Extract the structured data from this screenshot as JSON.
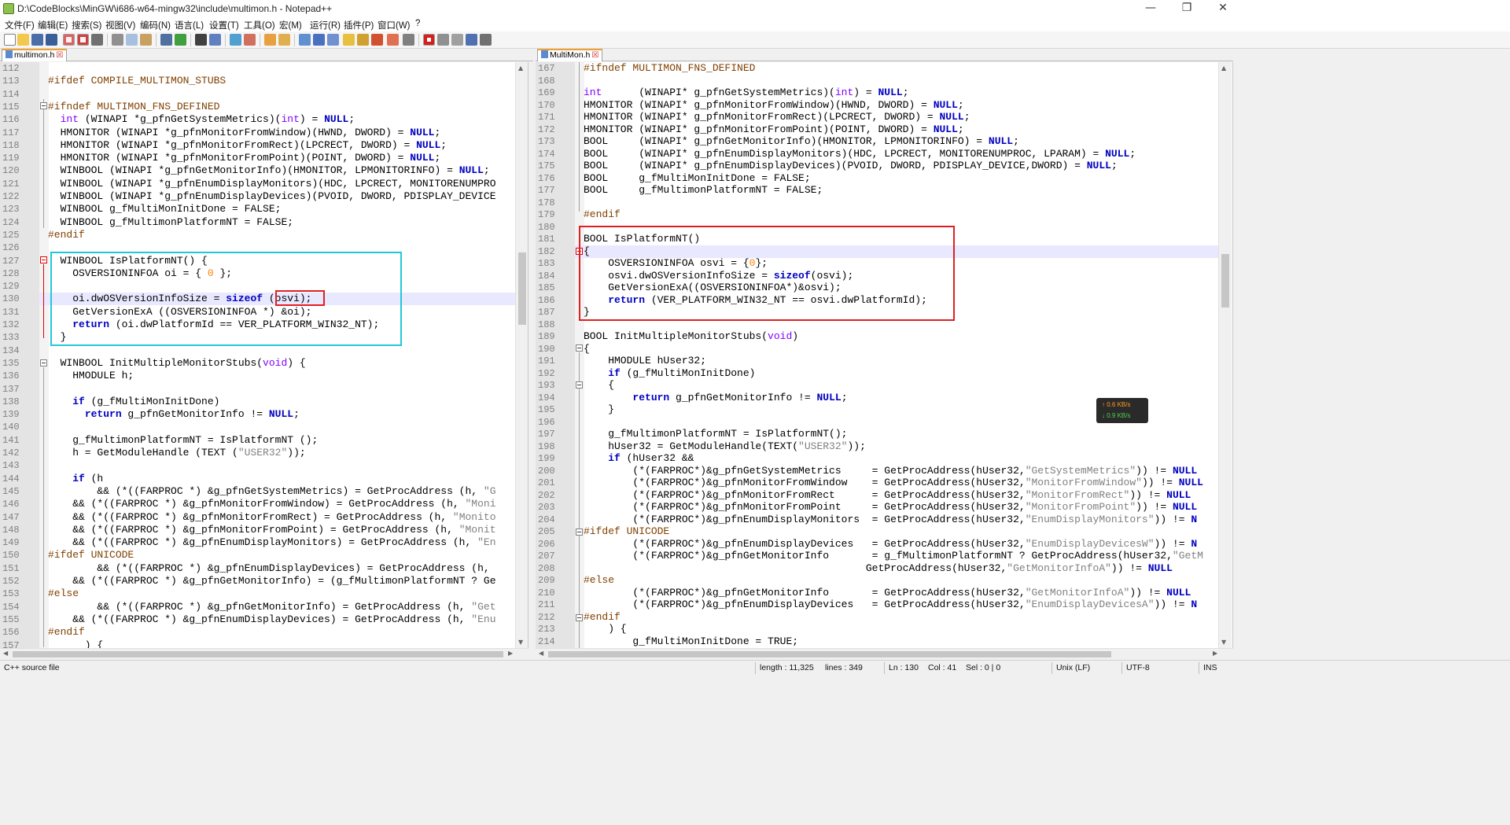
{
  "window": {
    "title": "D:\\CodeBlocks\\MinGW\\i686-w64-mingw32\\include\\multimon.h - Notepad++",
    "minimize_glyph": "—",
    "restore_glyph": "❐",
    "close_glyph": "✕"
  },
  "menu": [
    "文件(F)",
    "编辑(E)",
    "搜索(S)",
    "视图(V)",
    "编码(N)",
    "语言(L)",
    "设置(T)",
    "工具(O)",
    "宏(M)",
    "运行(R)",
    "插件(P)",
    "窗口(W)",
    "?"
  ],
  "toolbar_icons": [
    "new-file-icon",
    "open-file-icon",
    "save-icon",
    "save-all-icon",
    "close-icon",
    "close-all-icon",
    "print-icon",
    "cut-icon",
    "copy-icon",
    "paste-icon",
    "undo-icon",
    "redo-icon",
    "find-icon",
    "replace-icon",
    "zoom-in-icon",
    "zoom-out-icon",
    "sync-vertical-icon",
    "sync-horizontal-icon",
    "word-wrap-icon",
    "show-all-chars-icon",
    "indent-guide-icon",
    "udl-icon",
    "doc-map-icon",
    "function-list-icon",
    "folder-workspace-icon",
    "monitoring-icon",
    "record-macro-icon",
    "stop-record-icon",
    "play-macro-icon",
    "run-macro-multiple-icon",
    "save-macro-icon"
  ],
  "left_tab": {
    "label": "multimon.h",
    "close": "☒"
  },
  "right_tab": {
    "label": "MultiMon.h",
    "close": "☒"
  },
  "left_lines": [
    {
      "n": "112",
      "html": ""
    },
    {
      "n": "113",
      "html": "<span class=\"p\">#ifdef COMPILE_MULTIMON_STUBS</span>"
    },
    {
      "n": "114",
      "html": ""
    },
    {
      "n": "115",
      "html": "<span class=\"p\">#ifndef MULTIMON_FNS_DEFINED</span>"
    },
    {
      "n": "116",
      "html": "  <span class=\"t\">int</span> (WINAPI *g_pfnGetSystemMetrics)(<span class=\"t\">int</span>) = <span class=\"k\">NULL</span>;"
    },
    {
      "n": "117",
      "html": "  HMONITOR (WINAPI *g_pfnMonitorFromWindow)(HWND, DWORD) = <span class=\"k\">NULL</span>;"
    },
    {
      "n": "118",
      "html": "  HMONITOR (WINAPI *g_pfnMonitorFromRect)(LPCRECT, DWORD) = <span class=\"k\">NULL</span>;"
    },
    {
      "n": "119",
      "html": "  HMONITOR (WINAPI *g_pfnMonitorFromPoint)(POINT, DWORD) = <span class=\"k\">NULL</span>;"
    },
    {
      "n": "120",
      "html": "  WINBOOL (WINAPI *g_pfnGetMonitorInfo)(HMONITOR, LPMONITORINFO) = <span class=\"k\">NULL</span>;"
    },
    {
      "n": "121",
      "html": "  WINBOOL (WINAPI *g_pfnEnumDisplayMonitors)(HDC, LPCRECT, MONITORENUMPRO"
    },
    {
      "n": "122",
      "html": "  WINBOOL (WINAPI *g_pfnEnumDisplayDevices)(PVOID, DWORD, PDISPLAY_DEVICE"
    },
    {
      "n": "123",
      "html": "  WINBOOL g_fMultiMonInitDone = FALSE;"
    },
    {
      "n": "124",
      "html": "  WINBOOL g_fMultimonPlatformNT = FALSE;"
    },
    {
      "n": "125",
      "html": "<span class=\"p\">#endif</span>"
    },
    {
      "n": "126",
      "html": ""
    },
    {
      "n": "127",
      "html": "  WINBOOL IsPlatformNT() {"
    },
    {
      "n": "128",
      "html": "    OSVERSIONINFOA oi = { <span class=\"n\">0</span> };"
    },
    {
      "n": "129",
      "html": ""
    },
    {
      "n": "130",
      "html": "    oi.dwOSVersionInfoSize = <span class=\"k\">sizeof</span> (osvi);"
    },
    {
      "n": "131",
      "html": "    GetVersionExA ((OSVERSIONINFOA *) &amp;oi);"
    },
    {
      "n": "132",
      "html": "    <span class=\"k\">return</span> (oi.dwPlatformId == VER_PLATFORM_WIN32_NT);"
    },
    {
      "n": "133",
      "html": "  }"
    },
    {
      "n": "134",
      "html": ""
    },
    {
      "n": "135",
      "html": "  WINBOOL InitMultipleMonitorStubs(<span class=\"t\">void</span>) {"
    },
    {
      "n": "136",
      "html": "    HMODULE h;"
    },
    {
      "n": "137",
      "html": ""
    },
    {
      "n": "138",
      "html": "    <span class=\"k\">if</span> (g_fMultiMonInitDone)"
    },
    {
      "n": "139",
      "html": "      <span class=\"k\">return</span> g_pfnGetMonitorInfo != <span class=\"k\">NULL</span>;"
    },
    {
      "n": "140",
      "html": ""
    },
    {
      "n": "141",
      "html": "    g_fMultimonPlatformNT = IsPlatformNT ();"
    },
    {
      "n": "142",
      "html": "    h = GetModuleHandle (TEXT (<span class=\"s\">\"USER32\"</span>));"
    },
    {
      "n": "143",
      "html": ""
    },
    {
      "n": "144",
      "html": "    <span class=\"k\">if</span> (h"
    },
    {
      "n": "145",
      "html": "        &amp;&amp; (*((FARPROC *) &amp;g_pfnGetSystemMetrics) = GetProcAddress (h, <span class=\"s\">\"G</span>"
    },
    {
      "n": "146",
      "html": "    &amp;&amp; (*((FARPROC *) &amp;g_pfnMonitorFromWindow) = GetProcAddress (h, <span class=\"s\">\"Moni</span>"
    },
    {
      "n": "147",
      "html": "    &amp;&amp; (*((FARPROC *) &amp;g_pfnMonitorFromRect) = GetProcAddress (h, <span class=\"s\">\"Monito</span>"
    },
    {
      "n": "148",
      "html": "    &amp;&amp; (*((FARPROC *) &amp;g_pfnMonitorFromPoint) = GetProcAddress (h, <span class=\"s\">\"Monit</span>"
    },
    {
      "n": "149",
      "html": "    &amp;&amp; (*((FARPROC *) &amp;g_pfnEnumDisplayMonitors) = GetProcAddress (h, <span class=\"s\">\"En</span>"
    },
    {
      "n": "150",
      "html": "<span class=\"p\">#ifdef UNICODE</span>"
    },
    {
      "n": "151",
      "html": "        &amp;&amp; (*((FARPROC *) &amp;g_pfnEnumDisplayDevices) = GetProcAddress (h,"
    },
    {
      "n": "152",
      "html": "    &amp;&amp; (*((FARPROC *) &amp;g_pfnGetMonitorInfo) = (g_fMultimonPlatformNT ? Ge"
    },
    {
      "n": "153",
      "html": "<span class=\"p\">#else</span>"
    },
    {
      "n": "154",
      "html": "        &amp;&amp; (*((FARPROC *) &amp;g_pfnGetMonitorInfo) = GetProcAddress (h, <span class=\"s\">\"Get</span>"
    },
    {
      "n": "155",
      "html": "    &amp;&amp; (*((FARPROC *) &amp;g_pfnEnumDisplayDevices) = GetProcAddress (h, <span class=\"s\">\"Enu</span>"
    },
    {
      "n": "156",
      "html": "<span class=\"p\">#endif</span>"
    },
    {
      "n": "157",
      "html": "      ) {"
    }
  ],
  "right_lines": [
    {
      "n": "167",
      "html": "<span class=\"p\">#ifndef MULTIMON_FNS_DEFINED</span>"
    },
    {
      "n": "168",
      "html": ""
    },
    {
      "n": "169",
      "html": "<span class=\"t\">int</span>      (WINAPI* g_pfnGetSystemMetrics)(<span class=\"t\">int</span>) = <span class=\"k\">NULL</span>;"
    },
    {
      "n": "170",
      "html": "HMONITOR (WINAPI* g_pfnMonitorFromWindow)(HWND, DWORD) = <span class=\"k\">NULL</span>;"
    },
    {
      "n": "171",
      "html": "HMONITOR (WINAPI* g_pfnMonitorFromRect)(LPCRECT, DWORD) = <span class=\"k\">NULL</span>;"
    },
    {
      "n": "172",
      "html": "HMONITOR (WINAPI* g_pfnMonitorFromPoint)(POINT, DWORD) = <span class=\"k\">NULL</span>;"
    },
    {
      "n": "173",
      "html": "BOOL     (WINAPI* g_pfnGetMonitorInfo)(HMONITOR, LPMONITORINFO) = <span class=\"k\">NULL</span>;"
    },
    {
      "n": "174",
      "html": "BOOL     (WINAPI* g_pfnEnumDisplayMonitors)(HDC, LPCRECT, MONITORENUMPROC, LPARAM) = <span class=\"k\">NULL</span>;"
    },
    {
      "n": "175",
      "html": "BOOL     (WINAPI* g_pfnEnumDisplayDevices)(PVOID, DWORD, PDISPLAY_DEVICE,DWORD) = <span class=\"k\">NULL</span>;"
    },
    {
      "n": "176",
      "html": "BOOL     g_fMultiMonInitDone = FALSE;"
    },
    {
      "n": "177",
      "html": "BOOL     g_fMultimonPlatformNT = FALSE;"
    },
    {
      "n": "178",
      "html": ""
    },
    {
      "n": "179",
      "html": "<span class=\"p\">#endif</span>"
    },
    {
      "n": "180",
      "html": ""
    },
    {
      "n": "181",
      "html": "BOOL IsPlatformNT()"
    },
    {
      "n": "182",
      "html": "{"
    },
    {
      "n": "183",
      "html": "    OSVERSIONINFOA osvi = {<span class=\"n\">0</span>};"
    },
    {
      "n": "184",
      "html": "    osvi.dwOSVersionInfoSize = <span class=\"k\">sizeof</span>(osvi);"
    },
    {
      "n": "185",
      "html": "    GetVersionExA((OSVERSIONINFOA*)&amp;osvi);"
    },
    {
      "n": "186",
      "html": "    <span class=\"k\">return</span> (VER_PLATFORM_WIN32_NT == osvi.dwPlatformId);"
    },
    {
      "n": "187",
      "html": "}"
    },
    {
      "n": "188",
      "html": ""
    },
    {
      "n": "189",
      "html": "BOOL InitMultipleMonitorStubs(<span class=\"t\">void</span>)"
    },
    {
      "n": "190",
      "html": "{"
    },
    {
      "n": "191",
      "html": "    HMODULE hUser32;"
    },
    {
      "n": "192",
      "html": "    <span class=\"k\">if</span> (g_fMultiMonInitDone)"
    },
    {
      "n": "193",
      "html": "    {"
    },
    {
      "n": "194",
      "html": "        <span class=\"k\">return</span> g_pfnGetMonitorInfo != <span class=\"k\">NULL</span>;"
    },
    {
      "n": "195",
      "html": "    }"
    },
    {
      "n": "196",
      "html": ""
    },
    {
      "n": "197",
      "html": "    g_fMultimonPlatformNT = IsPlatformNT();"
    },
    {
      "n": "198",
      "html": "    hUser32 = GetModuleHandle(TEXT(<span class=\"s\">\"USER32\"</span>));"
    },
    {
      "n": "199",
      "html": "    <span class=\"k\">if</span> (hUser32 &amp;&amp;"
    },
    {
      "n": "200",
      "html": "        (*(FARPROC*)&amp;g_pfnGetSystemMetrics     = GetProcAddress(hUser32,<span class=\"s\">\"GetSystemMetrics\"</span>)) != <span class=\"k\">NULL</span>"
    },
    {
      "n": "201",
      "html": "        (*(FARPROC*)&amp;g_pfnMonitorFromWindow    = GetProcAddress(hUser32,<span class=\"s\">\"MonitorFromWindow\"</span>)) != <span class=\"k\">NULL</span>"
    },
    {
      "n": "202",
      "html": "        (*(FARPROC*)&amp;g_pfnMonitorFromRect      = GetProcAddress(hUser32,<span class=\"s\">\"MonitorFromRect\"</span>)) != <span class=\"k\">NULL</span>"
    },
    {
      "n": "203",
      "html": "        (*(FARPROC*)&amp;g_pfnMonitorFromPoint     = GetProcAddress(hUser32,<span class=\"s\">\"MonitorFromPoint\"</span>)) != <span class=\"k\">NULL</span>"
    },
    {
      "n": "204",
      "html": "        (*(FARPROC*)&amp;g_pfnEnumDisplayMonitors  = GetProcAddress(hUser32,<span class=\"s\">\"EnumDisplayMonitors\"</span>)) != <span class=\"k\">N</span>"
    },
    {
      "n": "205",
      "html": "<span class=\"p\">#ifdef UNICODE</span>"
    },
    {
      "n": "206",
      "html": "        (*(FARPROC*)&amp;g_pfnEnumDisplayDevices   = GetProcAddress(hUser32,<span class=\"s\">\"EnumDisplayDevicesW\"</span>)) != <span class=\"k\">N</span>"
    },
    {
      "n": "207",
      "html": "        (*(FARPROC*)&amp;g_pfnGetMonitorInfo       = g_fMultimonPlatformNT ? GetProcAddress(hUser32,<span class=\"s\">\"GetM</span>"
    },
    {
      "n": "208",
      "html": "                                              GetProcAddress(hUser32,<span class=\"s\">\"GetMonitorInfoA\"</span>)) != <span class=\"k\">NULL</span>"
    },
    {
      "n": "209",
      "html": "<span class=\"p\">#else</span>"
    },
    {
      "n": "210",
      "html": "        (*(FARPROC*)&amp;g_pfnGetMonitorInfo       = GetProcAddress(hUser32,<span class=\"s\">\"GetMonitorInfoA\"</span>)) != <span class=\"k\">NULL</span>"
    },
    {
      "n": "211",
      "html": "        (*(FARPROC*)&amp;g_pfnEnumDisplayDevices   = GetProcAddress(hUser32,<span class=\"s\">\"EnumDisplayDevicesA\"</span>)) != <span class=\"k\">N</span>"
    },
    {
      "n": "212",
      "html": "<span class=\"p\">#endif</span>"
    },
    {
      "n": "213",
      "html": "    ) {"
    },
    {
      "n": "214",
      "html": "        g_fMultiMonInitDone = TRUE;"
    }
  ],
  "netspeed": {
    "up": "↑ 0.6 KB/s",
    "down": "↓ 0.9 KB/s"
  },
  "status": {
    "file_type": "C++ source file",
    "length": "length : 11,325",
    "lines": "lines : 349",
    "ln": "Ln : 130",
    "col": "Col : 41",
    "sel": "Sel : 0 | 0",
    "eol": "Unix (LF)",
    "encoding": "UTF-8",
    "insert_mode": "INS"
  }
}
